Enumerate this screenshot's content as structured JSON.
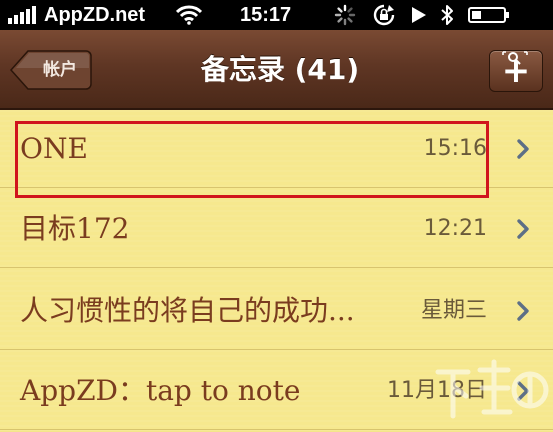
{
  "status_bar": {
    "carrier": "AppZD.net",
    "time": "15:17"
  },
  "nav": {
    "back_label": "帐户",
    "title": "备忘录 (41)",
    "add_label": "+"
  },
  "notes": [
    {
      "title": "ONE",
      "date": "15:16"
    },
    {
      "title": "目标172",
      "date": "12:21"
    },
    {
      "title": "人习惯性的将自己的成功...",
      "date": "星期三"
    },
    {
      "title": "AppZD：tap to note",
      "date": "11月18日"
    }
  ],
  "colors": {
    "paper": "#f6e88e",
    "nav_brown": "#5f3624",
    "note_text": "#7a3c1f",
    "highlight": "#d0151d"
  },
  "icons": [
    "wifi-icon",
    "activity-spinner-icon",
    "rotation-lock-icon",
    "play-icon",
    "bluetooth-icon",
    "battery-icon",
    "zoom-icon",
    "chevron-right-icon"
  ]
}
